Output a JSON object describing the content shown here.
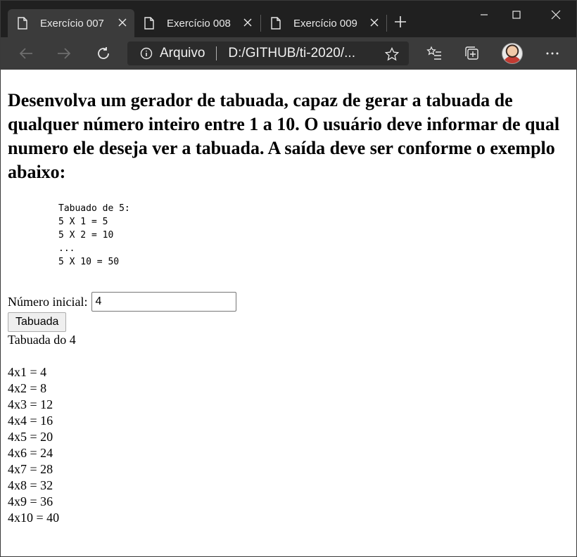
{
  "browser": {
    "tabs": [
      {
        "label": "Exercício 007",
        "active": true
      },
      {
        "label": "Exercício 008",
        "active": false
      },
      {
        "label": "Exercício 009",
        "active": false
      }
    ],
    "address": {
      "scheme": "Arquivo",
      "url": "D:/GITHUB/ti-2020/..."
    }
  },
  "page": {
    "heading": "Desenvolva um gerador de tabuada, capaz de gerar a tabuada de qualquer número inteiro entre 1 a 10. O usuário deve informar de qual numero ele deseja ver a tabuada. A saída deve ser conforme o exemplo abaixo:",
    "example": [
      "Tabuado de 5:",
      "5 X 1 = 5",
      "5 X 2 = 10",
      "...",
      "5 X 10 = 50"
    ],
    "input_label": "Número inicial:",
    "input_value": "4",
    "button_label": "Tabuada",
    "result_title": "Tabuada do 4",
    "result_rows": [
      "4x1 = 4",
      "4x2 = 8",
      "4x3 = 12",
      "4x4 = 16",
      "4x5 = 20",
      "4x6 = 24",
      "4x7 = 28",
      "4x8 = 32",
      "4x9 = 36",
      "4x10 = 40"
    ]
  },
  "colors": {
    "titlebar": "#202020",
    "toolbar": "#3b3b3b",
    "addressbar": "#2b2b2b"
  }
}
